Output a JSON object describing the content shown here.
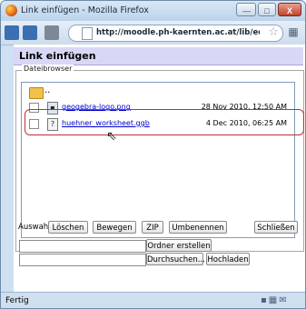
{
  "window": {
    "title": "Link einfügen - Mozilla Firefox",
    "min_label": "—",
    "max_label": "□",
    "close_label": "X"
  },
  "navbar": {
    "url": "http://moodle.ph-kaernten.ac.at/lib/editor/htmlar"
  },
  "page": {
    "heading": "Link einfügen",
    "filebrowser_legend": "Dateibrowser",
    "up_label": "..",
    "files": [
      {
        "name": "geogebra-logo.png",
        "date": "28 Nov 2010, 12:50 AM",
        "icon": "image-file-icon"
      },
      {
        "name": "huehner_worksheet.ggb",
        "date": "4 Dec 2010, 06:25 AM",
        "icon": "unknown-file-icon"
      }
    ],
    "selection_label": "Auswahl:",
    "buttons": {
      "delete": "Löschen",
      "move": "Bewegen",
      "zip": "ZIP",
      "rename": "Umbenennen",
      "close": "Schließen",
      "create_folder": "Ordner erstellen",
      "browse": "Durchsuchen...",
      "upload": "Hochladen"
    }
  },
  "status": {
    "text": "Fertig"
  },
  "colors": {
    "heading_bg": "#d8d8f6",
    "link": "#0000cc",
    "highlight": "#c03030"
  }
}
